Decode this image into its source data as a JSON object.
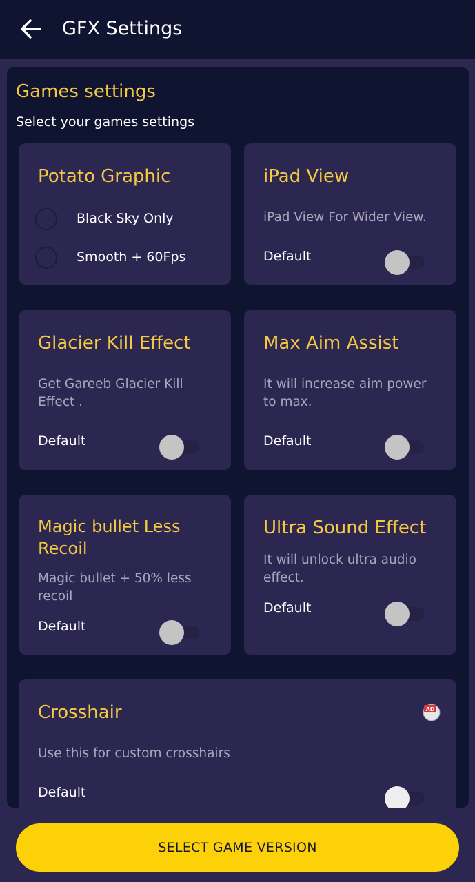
{
  "header": {
    "title": "GFX Settings",
    "back_icon": "arrow-left-icon"
  },
  "section": {
    "title": "Games settings",
    "subtitle": "Select your games settings"
  },
  "cards": {
    "potato": {
      "title": "Potato Graphic",
      "options": [
        {
          "label": "Black Sky Only",
          "selected": false
        },
        {
          "label": "Smooth + 60Fps",
          "selected": false
        }
      ]
    },
    "ipad": {
      "title": "iPad View",
      "desc": "iPad View For Wider View.",
      "label": "Default",
      "on": false
    },
    "glacier": {
      "title": "Glacier Kill Effect",
      "desc_line1": "Get Gareeb Glacier Kill",
      "desc_line2": "Effect .",
      "label": "Default",
      "on": false
    },
    "aim": {
      "title": "Max Aim Assist",
      "desc_line1": "It will increase aim power",
      "desc_line2": "to max.",
      "label": "Default",
      "on": false
    },
    "magic": {
      "title_line1": "Magic bullet Less",
      "title_line2": "Recoil",
      "desc_line1": "Magic bullet + 50% less",
      "desc_line2": "recoil",
      "label": "Default",
      "on": false
    },
    "sound": {
      "title": "Ultra Sound Effect",
      "desc_line1": "It will unlock ultra audio",
      "desc_line2": "effect.",
      "label": "Default",
      "on": false
    },
    "crosshair": {
      "title": "Crosshair",
      "desc": "Use this for custom crosshairs",
      "label": "Default",
      "on": false,
      "badge": "AD",
      "badge_icon": "ad-badge-icon"
    }
  },
  "colors": {
    "accent_yellow": "#f5c842",
    "cta_yellow": "#fcd107",
    "card_bg": "#2b2750",
    "panel_bg": "#0f1530"
  },
  "footer": {
    "cta_label": "SELECT GAME VERSION"
  }
}
